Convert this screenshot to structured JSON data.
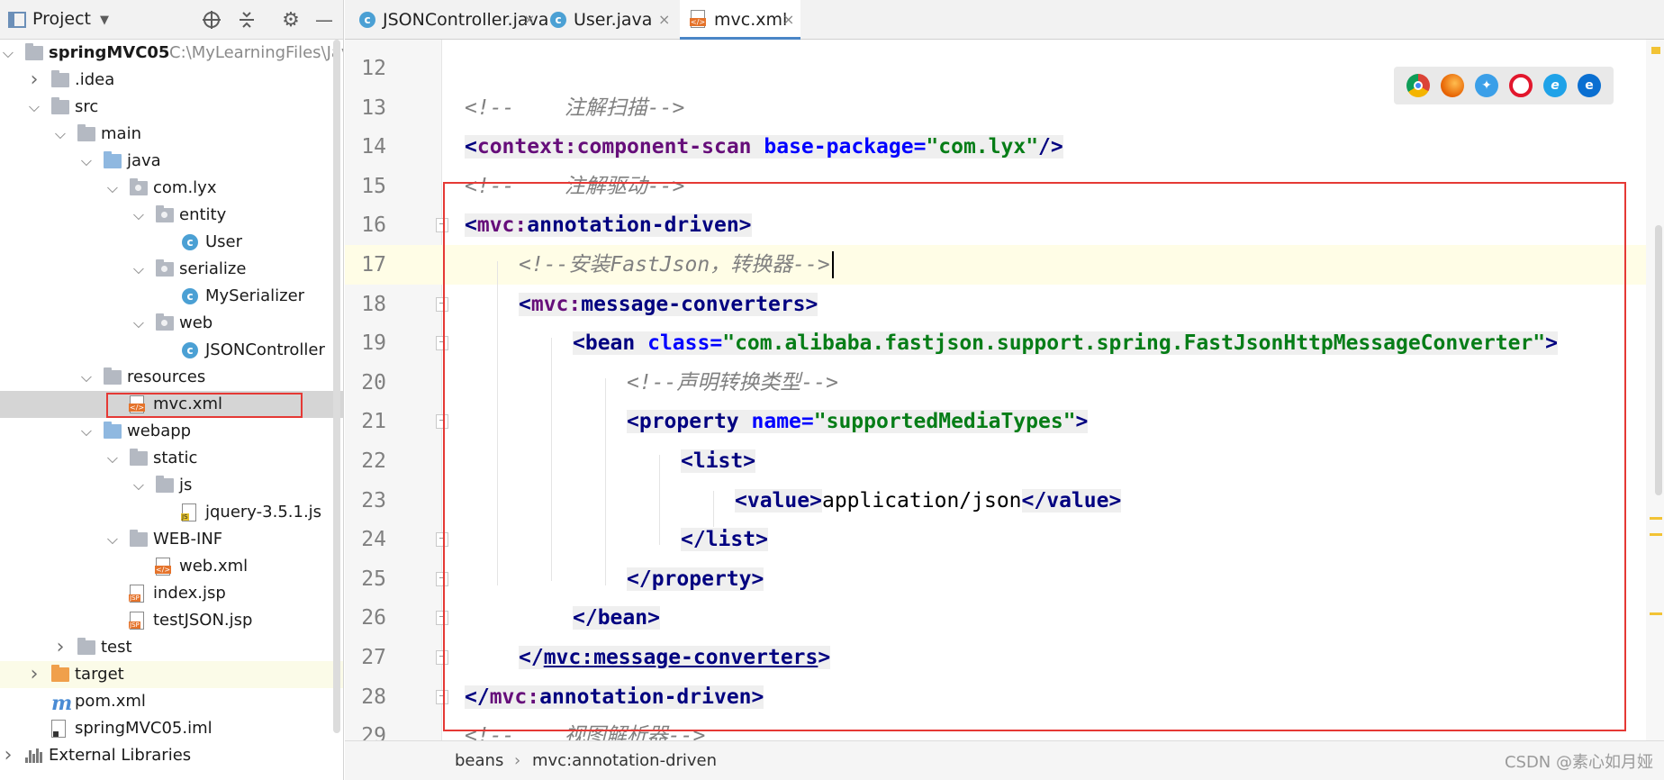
{
  "project_panel": {
    "title": "Project",
    "icons": [
      "globe-target-icon",
      "collapse-icon",
      "gear-icon",
      "minimize-icon"
    ],
    "tree": [
      {
        "label": "springMVC05",
        "path": "C:\\MyLearningFiles\\Jav",
        "icon": "module",
        "bold": true
      },
      {
        "label": ".idea",
        "icon": "folder"
      },
      {
        "label": "src",
        "icon": "folder"
      },
      {
        "label": "main",
        "icon": "folder"
      },
      {
        "label": "java",
        "icon": "folder-blue"
      },
      {
        "label": "com.lyx",
        "icon": "package"
      },
      {
        "label": "entity",
        "icon": "package"
      },
      {
        "label": "User",
        "icon": "class"
      },
      {
        "label": "serialize",
        "icon": "package"
      },
      {
        "label": "MySerializer",
        "icon": "class"
      },
      {
        "label": "web",
        "icon": "package"
      },
      {
        "label": "JSONController",
        "icon": "class"
      },
      {
        "label": "resources",
        "icon": "folder-res"
      },
      {
        "label": "mvc.xml",
        "icon": "xml",
        "selected": true
      },
      {
        "label": "webapp",
        "icon": "folder-web"
      },
      {
        "label": "static",
        "icon": "folder"
      },
      {
        "label": "js",
        "icon": "folder"
      },
      {
        "label": "jquery-3.5.1.js",
        "icon": "js"
      },
      {
        "label": "WEB-INF",
        "icon": "folder"
      },
      {
        "label": "web.xml",
        "icon": "xml"
      },
      {
        "label": "index.jsp",
        "icon": "jsp"
      },
      {
        "label": "testJSON.jsp",
        "icon": "jsp"
      },
      {
        "label": "test",
        "icon": "folder"
      },
      {
        "label": "target",
        "icon": "folder-orange"
      },
      {
        "label": "pom.xml",
        "icon": "maven"
      },
      {
        "label": "springMVC05.iml",
        "icon": "iml"
      },
      {
        "label": "External Libraries",
        "icon": "libraries"
      }
    ]
  },
  "tabs": [
    {
      "label": "JSONController.java",
      "icon": "class"
    },
    {
      "label": "User.java",
      "icon": "class"
    },
    {
      "label": "mvc.xml",
      "icon": "xml",
      "active": true
    }
  ],
  "tab_close_glyph": "×",
  "code_lines": [
    {
      "n": "12",
      "kind": "blank"
    },
    {
      "n": "13",
      "kind": "comment",
      "text": "<!--    注解扫描-->"
    },
    {
      "n": "14",
      "kind": "scan",
      "open": "<",
      "ns": "context",
      "sep": ":",
      "tag": "component-scan",
      "attr": "base-package",
      "eq": "=",
      "val": "\"com.lyx\"",
      "close": "/>"
    },
    {
      "n": "15",
      "kind": "comment",
      "text": "<!--    注解驱动-->"
    },
    {
      "n": "16",
      "kind": "open",
      "open": "<",
      "ns": "mvc",
      "sep": ":",
      "tag": "annotation-driven",
      "close": ">"
    },
    {
      "n": "17",
      "kind": "comment",
      "text": "<!--安装FastJson，转换器-->"
    },
    {
      "n": "18",
      "kind": "open",
      "open": "<",
      "ns": "mvc",
      "sep": ":",
      "tag": "message-converters",
      "close": ">"
    },
    {
      "n": "19",
      "kind": "bean",
      "open": "<",
      "tag": "bean",
      "attr": "class",
      "eq": "=",
      "val": "\"com.alibaba.fastjson.support.spring.FastJsonHttpMessageConverter\"",
      "close": ">"
    },
    {
      "n": "20",
      "kind": "comment",
      "text": "<!--声明转换类型-->"
    },
    {
      "n": "21",
      "kind": "prop",
      "open": "<",
      "tag": "property",
      "attr": "name",
      "eq": "=",
      "val": "\"supportedMediaTypes\"",
      "close": ">"
    },
    {
      "n": "22",
      "kind": "simple",
      "text_open": "<",
      "tag": "list",
      "close": ">"
    },
    {
      "n": "23",
      "kind": "value",
      "open": "<",
      "tag": "value",
      "gt": ">",
      "text": "application/json",
      "endopen": "</",
      "endtag": "value",
      "endclose": ">"
    },
    {
      "n": "24",
      "kind": "simple",
      "text_open": "</",
      "tag": "list",
      "close": ">"
    },
    {
      "n": "25",
      "kind": "simple",
      "text_open": "</",
      "tag": "property",
      "close": ">"
    },
    {
      "n": "26",
      "kind": "simple",
      "text_open": "</",
      "tag": "bean",
      "close": ">"
    },
    {
      "n": "27",
      "kind": "closens-link",
      "open": "</",
      "ns": "mvc",
      "sep": ":",
      "tag": "message-converters",
      "close": ">"
    },
    {
      "n": "28",
      "kind": "closens",
      "open": "</",
      "ns": "mvc",
      "sep": ":",
      "tag": "annotation-driven",
      "close": ">"
    },
    {
      "n": "29",
      "kind": "comment",
      "text": "<!--    视图解析器-->"
    }
  ],
  "browser_icons": [
    "chrome-icon",
    "firefox-icon",
    "safari-icon",
    "opera-icon",
    "ie-icon",
    "edge-icon"
  ],
  "breadcrumb": {
    "items": [
      "beans",
      "mvc:annotation-driven"
    ],
    "sep": "›"
  },
  "watermark": "CSDN @素心如月娅",
  "colors": {
    "annotation_red": "#e53935",
    "accent_tab": "#4a86c7",
    "caret_line": "#fffde6"
  }
}
